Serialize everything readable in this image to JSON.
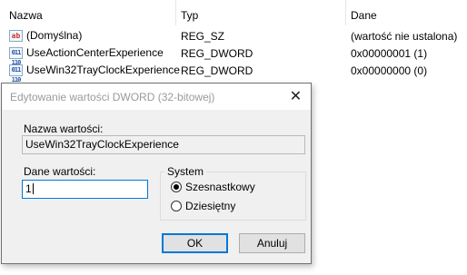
{
  "columns": {
    "name": "Nazwa",
    "type": "Typ",
    "data": "Dane"
  },
  "values": [
    {
      "icon": "ab",
      "name": "(Domyślna)",
      "type": "REG_SZ",
      "data": "(wartość nie ustalona)"
    },
    {
      "icon": "bin",
      "name": "UseActionCenterExperience",
      "type": "REG_DWORD",
      "data": "0x00000001 (1)"
    },
    {
      "icon": "bin",
      "name": "UseWin32TrayClockExperience",
      "type": "REG_DWORD",
      "data": "0x00000000 (0)"
    }
  ],
  "icons": {
    "ab": "ab",
    "bin": "011 110"
  },
  "dialog": {
    "title": "Edytowanie wartości DWORD (32-bitowej)",
    "close_glyph": "✕",
    "value_name_label": "Nazwa wartości:",
    "value_name": "UseWin32TrayClockExperience",
    "value_data_label": "Dane wartości:",
    "value_data": "1",
    "base_label": "System",
    "base_options": {
      "hex": "Szesnastkowy",
      "dec": "Dziesiętny"
    },
    "base_selected": "hex",
    "ok_label": "OK",
    "cancel_label": "Anuluj"
  },
  "colors": {
    "accent": "#0078d7",
    "dialog_bg": "#f0f0f0"
  }
}
